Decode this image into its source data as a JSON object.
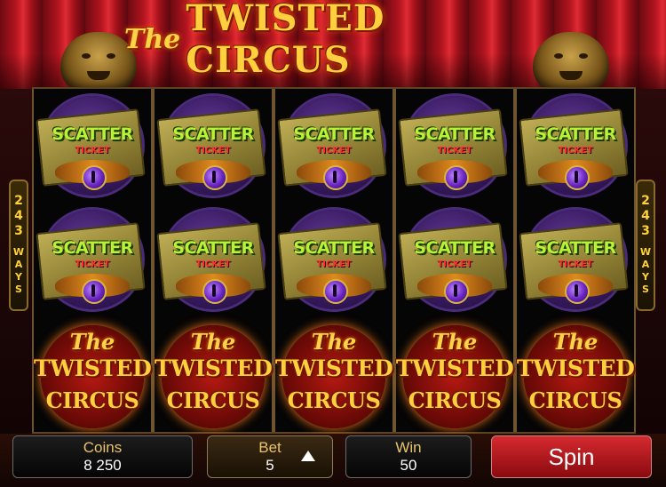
{
  "game": {
    "title_prefix": "The",
    "title_main": "TWISTED CIRCUS"
  },
  "reels": [
    [
      "scatter",
      "scatter",
      "logo"
    ],
    [
      "scatter",
      "scatter",
      "logo"
    ],
    [
      "scatter",
      "scatter",
      "logo"
    ],
    [
      "scatter",
      "scatter",
      "logo"
    ],
    [
      "scatter",
      "scatter",
      "logo"
    ]
  ],
  "symbols": {
    "scatter": {
      "line1": "SCATTER",
      "line2": "TICKET",
      "icon": "eye-ticket-icon"
    },
    "logo": {
      "line1": "The",
      "line2": "TWISTED",
      "line3": "CIRCUS",
      "icon": "circus-logo-icon"
    }
  },
  "ways_indicator": {
    "number": "243",
    "label": "WAYS"
  },
  "controls": {
    "coins_label": "Coins",
    "coins_value": "8 250",
    "bet_label": "Bet",
    "bet_value": "5",
    "win_label": "Win",
    "win_value": "50",
    "spin_label": "Spin"
  },
  "colors": {
    "curtain": "#b3151f",
    "title_gold": "#ffcf3d",
    "scatter_green": "#b8f03a",
    "spin_red": "#d52a30",
    "label_gold": "#e8c36a"
  }
}
